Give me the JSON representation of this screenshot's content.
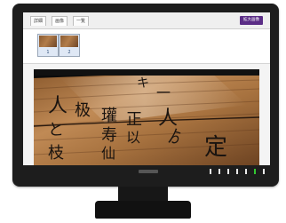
{
  "viewer": {
    "tabs": [
      "詳細",
      "画像",
      "一覧"
    ],
    "zoom_button": "拡大画像",
    "thumbnails": [
      {
        "number": "1"
      },
      {
        "number": "2"
      }
    ]
  },
  "colors": {
    "bezel": "#1d1d1d",
    "accent": "#5b2d86",
    "power_led": "#32c832"
  },
  "icons": {
    "thumbnail_image": "manuscript-thumbnail",
    "main_image": "wooden-tablet-photo"
  }
}
